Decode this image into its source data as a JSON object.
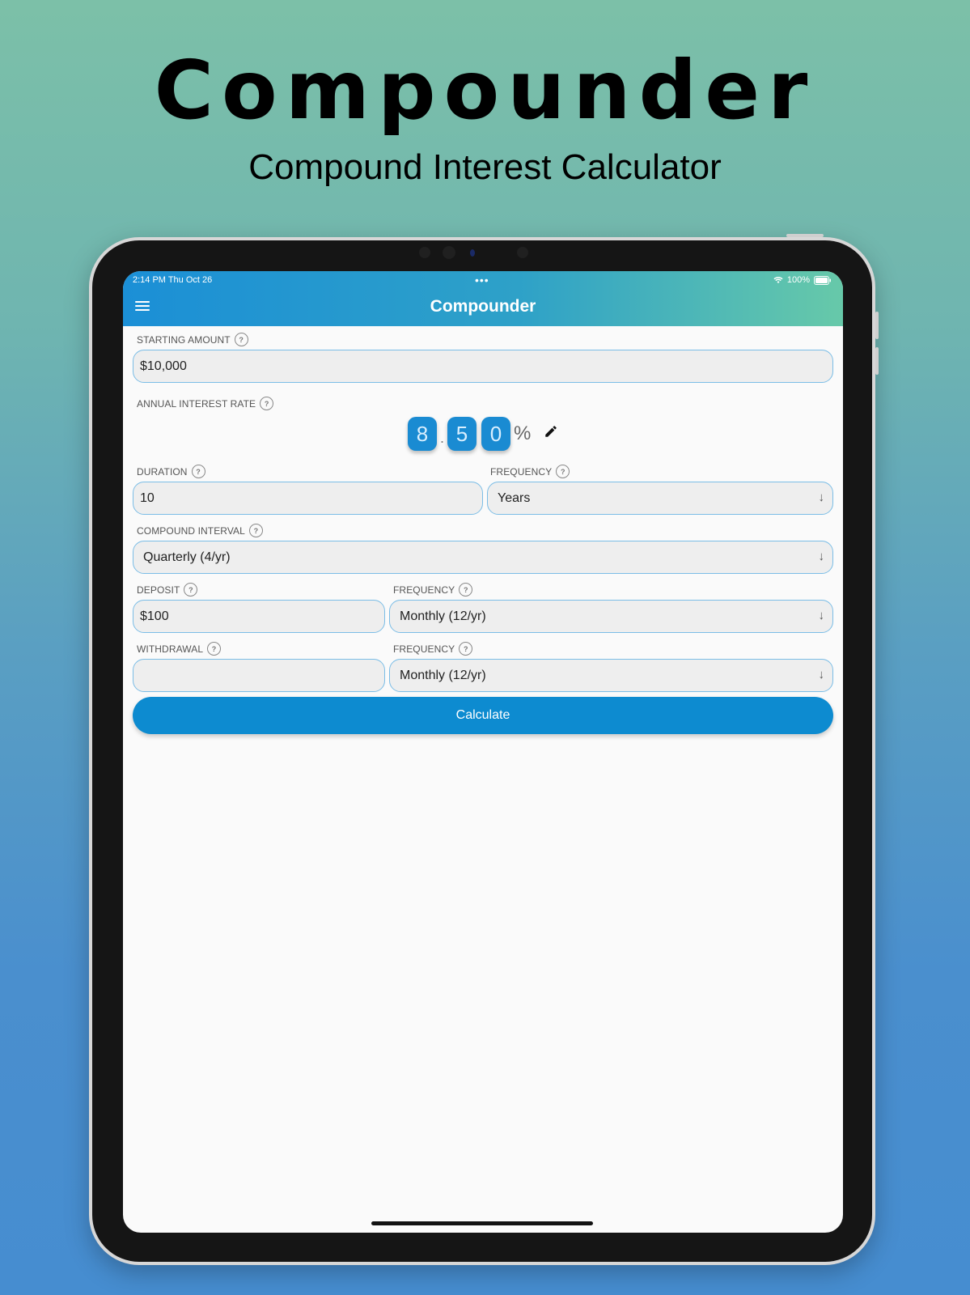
{
  "hero": {
    "title": "Compounder",
    "subtitle": "Compound Interest Calculator"
  },
  "status_bar": {
    "time_date": "2:14 PM   Thu Oct 26",
    "battery": "100%"
  },
  "app_bar": {
    "title": "Compounder",
    "menu_icon": "hamburger-icon"
  },
  "form": {
    "starting_amount": {
      "label": "STARTING AMOUNT",
      "value": "$10,000"
    },
    "interest_rate": {
      "label": "ANNUAL INTEREST RATE",
      "digits": [
        "8",
        "5",
        "0"
      ],
      "separator": ".",
      "unit": "%",
      "edit_icon": "pencil-icon"
    },
    "duration": {
      "label": "DURATION",
      "value": "10"
    },
    "duration_frequency": {
      "label": "FREQUENCY",
      "value": "Years"
    },
    "compound_interval": {
      "label": "COMPOUND INTERVAL",
      "value": "Quarterly (4/yr)"
    },
    "deposit": {
      "label": "DEPOSIT",
      "value": "$100"
    },
    "deposit_frequency": {
      "label": "FREQUENCY",
      "value": "Monthly (12/yr)"
    },
    "withdrawal": {
      "label": "WITHDRAWAL",
      "value": ""
    },
    "withdrawal_frequency": {
      "label": "FREQUENCY",
      "value": "Monthly (12/yr)"
    },
    "help_glyph": "?",
    "arrow_glyph": "↓",
    "calculate_label": "Calculate"
  },
  "colors": {
    "accent": "#0d8bd0",
    "appbar_start": "#1b8fd6",
    "appbar_end": "#67c9a9",
    "field_border": "#7bbde6"
  }
}
